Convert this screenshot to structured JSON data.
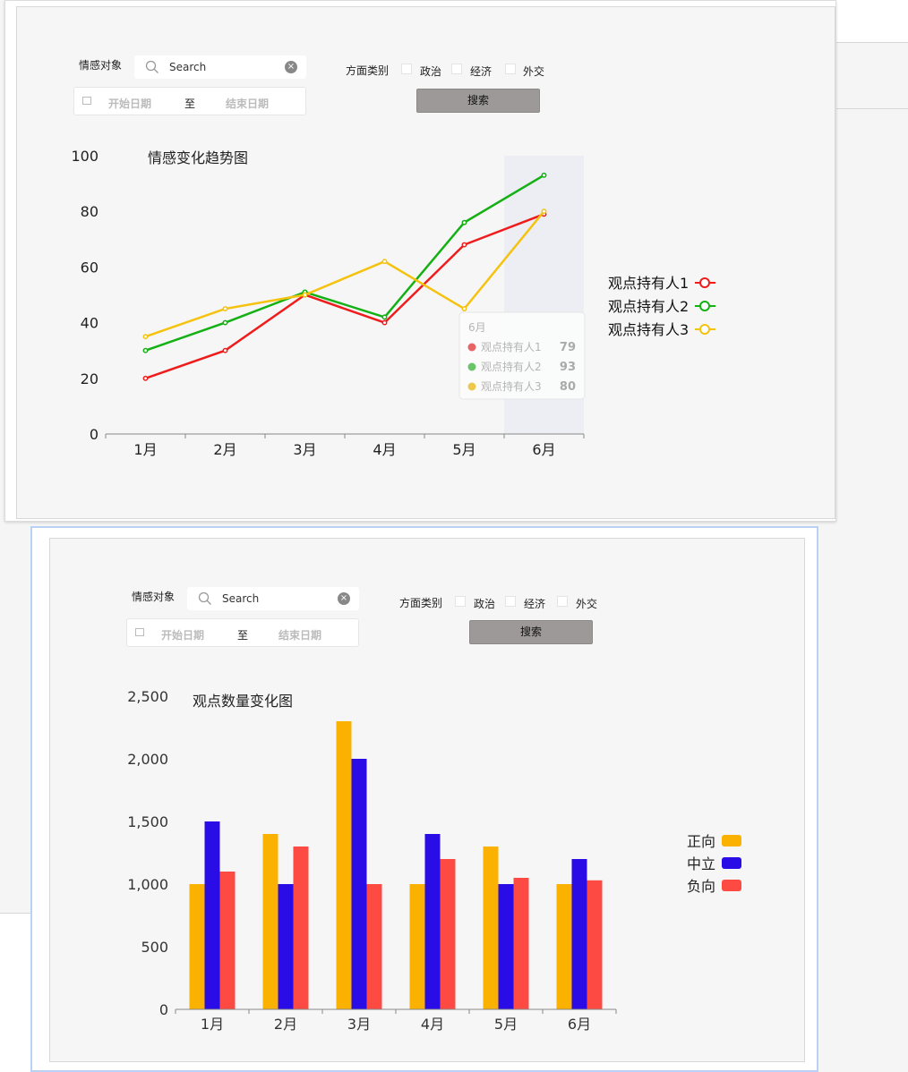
{
  "form": {
    "target_label": "情感对象",
    "search_placeholder": "Search",
    "category_label": "方面类别",
    "categories": [
      "政治",
      "经济",
      "外交"
    ],
    "start_date": "开始日期",
    "to": "至",
    "end_date": "结束日期",
    "search_button": "搜索"
  },
  "chart_data": [
    {
      "type": "line",
      "title": "情感变化趋势图",
      "categories": [
        "1月",
        "2月",
        "3月",
        "4月",
        "5月",
        "6月"
      ],
      "ylim": [
        0,
        100
      ],
      "yticks": [
        0,
        20,
        40,
        60,
        80,
        100
      ],
      "legend_position": "right",
      "series": [
        {
          "name": "观点持有人1",
          "color": "#ee1c1c",
          "values": [
            20,
            30,
            50,
            40,
            68,
            79
          ]
        },
        {
          "name": "观点持有人2",
          "color": "#14b014",
          "values": [
            30,
            40,
            51,
            42,
            76,
            93
          ]
        },
        {
          "name": "观点持有人3",
          "color": "#f5c20f",
          "values": [
            35,
            45,
            50,
            62,
            45,
            80
          ]
        }
      ],
      "tooltip": {
        "title": "6月",
        "rows": [
          {
            "name": "观点持有人1",
            "value": "79",
            "color": "#e86464"
          },
          {
            "name": "观点持有人2",
            "value": "93",
            "color": "#6ac46a"
          },
          {
            "name": "观点持有人3",
            "value": "80",
            "color": "#ecc84c"
          }
        ]
      }
    },
    {
      "type": "bar",
      "title": "观点数量变化图",
      "categories": [
        "1月",
        "2月",
        "3月",
        "4月",
        "5月",
        "6月"
      ],
      "ylim": [
        0,
        2500
      ],
      "yticks": [
        "0",
        "500",
        "1,000",
        "1,500",
        "2,000",
        "2,500"
      ],
      "legend_position": "right",
      "series": [
        {
          "name": "正向",
          "color": "#fbb100",
          "values": [
            1000,
            1400,
            2300,
            1000,
            1300,
            1000
          ]
        },
        {
          "name": "中立",
          "color": "#2a0ce6",
          "values": [
            1500,
            1000,
            2000,
            1400,
            1000,
            1200
          ]
        },
        {
          "name": "负向",
          "color": "#fd4b44",
          "values": [
            1100,
            1300,
            1000,
            1200,
            1050,
            1030
          ]
        }
      ]
    }
  ]
}
